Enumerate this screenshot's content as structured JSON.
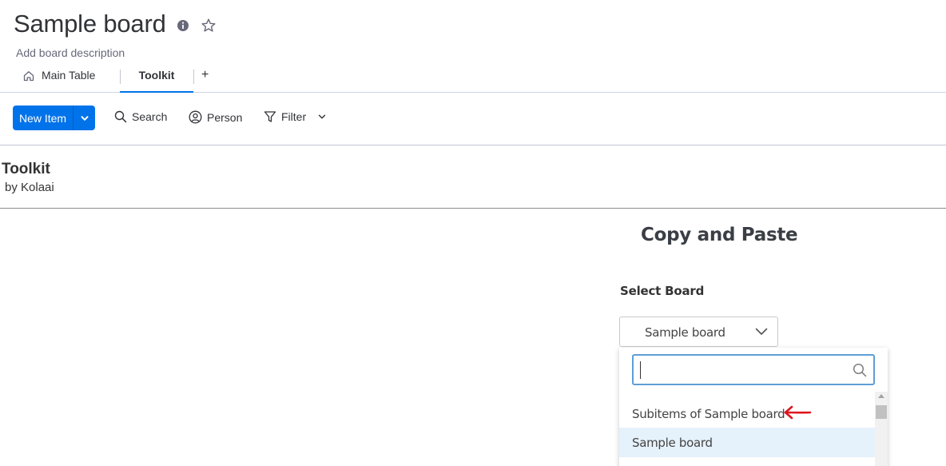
{
  "header": {
    "board_title": "Sample board",
    "board_description": "Add board description"
  },
  "tabs": [
    {
      "label": "Main Table",
      "icon": "home-icon",
      "active": false
    },
    {
      "label": "Toolkit",
      "active": true
    },
    {
      "label": "+",
      "icon": "plus-icon"
    }
  ],
  "toolbar": {
    "new_item_label": "New Item",
    "search_label": "Search",
    "person_label": "Person",
    "filter_label": "Filter"
  },
  "app": {
    "title": "Toolkit",
    "author": "by Kolaai"
  },
  "copy_paste": {
    "title": "Copy and Paste",
    "select_board_label": "Select Board",
    "selected_board": "Sample board",
    "search_value": "",
    "options": [
      {
        "label": "Subitems of Sample board",
        "highlighted": false,
        "annotated_with_arrow": true
      },
      {
        "label": "Sample board",
        "highlighted": true
      }
    ]
  },
  "colors": {
    "primary": "#0073ea",
    "highlight": "#e5f1fb",
    "focus_border": "#5e9ed6",
    "annotation_arrow": "#e0141e"
  }
}
